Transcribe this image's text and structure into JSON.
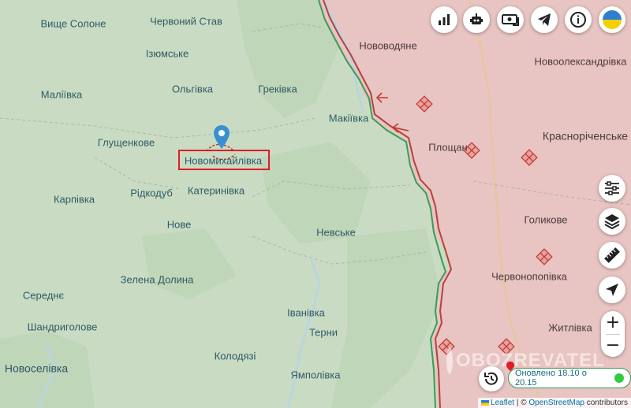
{
  "map": {
    "colors": {
      "ukraine_controlled": "#c9dcc3",
      "occupied": "#e8c4c2",
      "frontline": "#b5423c",
      "gray_zone": "#3c9a5a",
      "river": "#b9d5df",
      "marker": "#3a8fd1"
    },
    "places": [
      {
        "id": "vyshche-solone",
        "name": "Вище Солоне"
      },
      {
        "id": "chervonyi-stav",
        "name": "Червоний Став"
      },
      {
        "id": "iziumske",
        "name": "Ізюмське"
      },
      {
        "id": "novovodiane",
        "name": "Нововодяне"
      },
      {
        "id": "novooleksandrivka",
        "name": "Новоолександрівка"
      },
      {
        "id": "olhivka",
        "name": "Ольгівка"
      },
      {
        "id": "malivka",
        "name": "Маліївка"
      },
      {
        "id": "hrekivka",
        "name": "Греківка"
      },
      {
        "id": "makiivka",
        "name": "Макіївка"
      },
      {
        "id": "hlushchenkove",
        "name": "Глущенкове"
      },
      {
        "id": "krasnorichenske",
        "name": "Краснорiченськe"
      },
      {
        "id": "ploshchanka",
        "name": "Площан"
      },
      {
        "id": "novomykhailivka",
        "name": "Новомихайлівка"
      },
      {
        "id": "katerynivka",
        "name": "Катеринівка"
      },
      {
        "id": "ridkodub",
        "name": "Рідкодуб"
      },
      {
        "id": "karpivka",
        "name": "Карпівка"
      },
      {
        "id": "holykove",
        "name": "Голикове"
      },
      {
        "id": "nove",
        "name": "Нове"
      },
      {
        "id": "nevske",
        "name": "Невське"
      },
      {
        "id": "chervonopopivka",
        "name": "Червонопопівка"
      },
      {
        "id": "zelena-dolyna",
        "name": "Зелена Долина"
      },
      {
        "id": "seredne",
        "name": "Середнє"
      },
      {
        "id": "ivanivka",
        "name": "Іванівка"
      },
      {
        "id": "shandryholove",
        "name": "Шандриголове"
      },
      {
        "id": "zhytlivka",
        "name": "Житлівка"
      },
      {
        "id": "terny",
        "name": "Терни"
      },
      {
        "id": "kolodiazi",
        "name": "Колодязі"
      },
      {
        "id": "novoselivka",
        "name": "Новоселівка"
      },
      {
        "id": "yampolivka",
        "name": "Ямполівка"
      }
    ]
  },
  "controls": {
    "top": [
      "stats-icon",
      "robot-icon",
      "donate-icon",
      "telegram-icon",
      "info-icon",
      "ukraine-flag-icon"
    ],
    "side": [
      "filters-icon",
      "layers-icon",
      "ruler-icon",
      "locate-arrow-icon"
    ],
    "zoom_in": "+",
    "zoom_out": "−",
    "updated_label": "Оновлено 18.10 о 20.15",
    "status_color": "#2ecc40"
  },
  "attribution": {
    "leaflet": "Leaflet",
    "separator": " | © ",
    "osm": "OpenStreetMap",
    "contributors": " contributors"
  },
  "watermark": "OBOZREVATEL"
}
